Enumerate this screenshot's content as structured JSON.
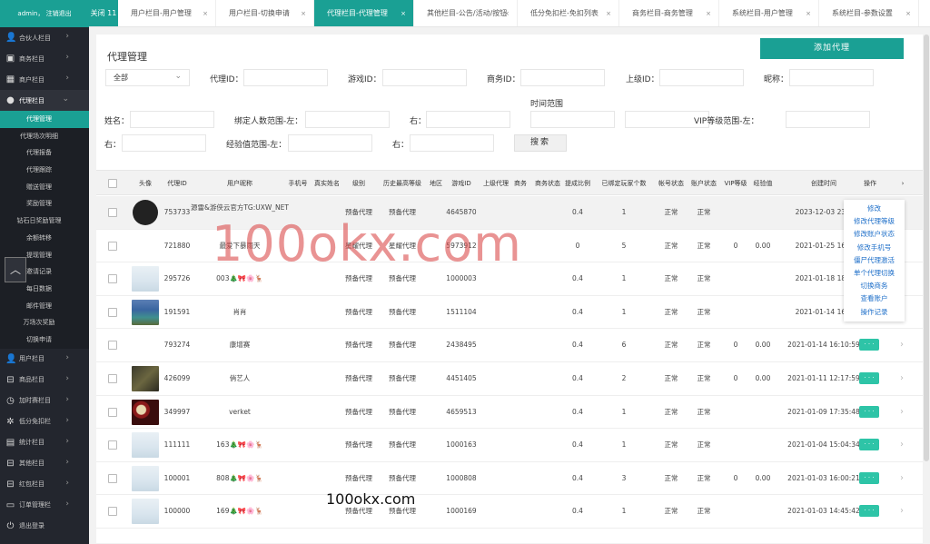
{
  "user_bar": "admin， 注销退出",
  "sidebar": {
    "items_top": [
      {
        "label": "合伙人栏目",
        "icon": "user-icon"
      },
      {
        "label": "商务栏目",
        "icon": "briefcase-icon"
      },
      {
        "label": "商户栏目",
        "icon": "shop-icon"
      },
      {
        "label": "代理栏目",
        "icon": "agent-icon"
      }
    ],
    "sub_items": [
      "代理管理",
      "代理场次明细",
      "代理报备",
      "代理跟踪",
      "赠送管理",
      "奖励管理",
      "钻石日奖励管理",
      "余额转移",
      "提现管理",
      "邀请记录",
      "每日数据",
      "邮件管理",
      "万场次奖励",
      "切换申请"
    ],
    "items_bottom": [
      {
        "label": "用户栏目",
        "icon": "user-icon"
      },
      {
        "label": "商品栏目",
        "icon": "bag-icon"
      },
      {
        "label": "加时赛栏目",
        "icon": "clock-icon"
      },
      {
        "label": "低分免扣栏",
        "icon": "gear-icon"
      },
      {
        "label": "统计栏目",
        "icon": "chart-icon"
      },
      {
        "label": "其他栏目",
        "icon": "bag-icon"
      },
      {
        "label": "红包栏目",
        "icon": "bag-icon"
      },
      {
        "label": "订单管理栏",
        "icon": "cart-icon"
      },
      {
        "label": "退出登录",
        "icon": "power-icon"
      }
    ]
  },
  "tabs": {
    "close_all": "关闭 11",
    "items": [
      {
        "label": "用户栏目-用户管理"
      },
      {
        "label": "用户栏目-切换申请"
      },
      {
        "label": "代理栏目-代理管理"
      },
      {
        "label": "其他栏目-公告/活动/按钮"
      },
      {
        "label": "低分免扣栏-免扣列表"
      },
      {
        "label": "商务栏目-商务管理"
      },
      {
        "label": "系统栏目-用户管理"
      },
      {
        "label": "系统栏目-参数设置"
      }
    ],
    "close_glyph": "×"
  },
  "page": {
    "title": "代理管理",
    "add_button": "添加代理"
  },
  "filters": {
    "select_value": "全部",
    "agent_id": "代理ID：",
    "game_id": "游戏ID：",
    "business_id": "商务ID：",
    "parent_id": "上级ID：",
    "nickname": "昵称：",
    "name": "姓名：",
    "bind_range_left": "绑定人数范围-左：",
    "right1": "右：",
    "time_range": "时间范围",
    "vip_range_left": "VIP等级范围-左：",
    "right2": "右：",
    "exp_range_left": "经验值范围-左：",
    "right3": "右：",
    "search": "搜索"
  },
  "table": {
    "headers": [
      "头像",
      "代理ID",
      "用户昵称",
      "手机号",
      "真实姓名",
      "级别",
      "历史最高等级",
      "地区",
      "游戏ID",
      "上级代理",
      "商务",
      "商务状态",
      "提成比例",
      "已绑定玩家个数",
      "帐号状态",
      "账户状态",
      "VIP等级",
      "经验值",
      "创建时间",
      "操作"
    ],
    "rows": [
      {
        "id": "753733",
        "nick": "源雷&游侠云官方TG:UXW_NET",
        "level": "预备代理",
        "hist": "预备代理",
        "game": "4645870",
        "rate": "0.4",
        "bound": "1",
        "acc": "正常",
        "bal": "正常",
        "vip": "",
        "exp": "",
        "time": "2023-12-03 23:3"
      },
      {
        "id": "721880",
        "nick": "最爱下暴雨天",
        "level": "星耀代理",
        "hist": "星耀代理",
        "game": "5973912",
        "rate": "0",
        "bound": "5",
        "acc": "正常",
        "bal": "正常",
        "vip": "0",
        "exp": "0.00",
        "time": "2021-01-25 16:4"
      },
      {
        "id": "295726",
        "nick": "003🎄🎀🌸🦌",
        "level": "预备代理",
        "hist": "预备代理",
        "game": "1000003",
        "rate": "0.4",
        "bound": "1",
        "acc": "正常",
        "bal": "正常",
        "vip": "",
        "exp": "",
        "time": "2021-01-18 18:1"
      },
      {
        "id": "191591",
        "nick": "肖肖",
        "level": "预备代理",
        "hist": "预备代理",
        "game": "1511104",
        "rate": "0.4",
        "bound": "1",
        "acc": "正常",
        "bal": "正常",
        "vip": "",
        "exp": "",
        "time": "2021-01-14 16:1"
      },
      {
        "id": "793274",
        "nick": "康增赛",
        "level": "预备代理",
        "hist": "预备代理",
        "game": "2438495",
        "rate": "0.4",
        "bound": "6",
        "acc": "正常",
        "bal": "正常",
        "vip": "0",
        "exp": "0.00",
        "time": "2021-01-14 16:10:59"
      },
      {
        "id": "426099",
        "nick": "俏艺人",
        "level": "预备代理",
        "hist": "预备代理",
        "game": "4451405",
        "rate": "0.4",
        "bound": "2",
        "acc": "正常",
        "bal": "正常",
        "vip": "0",
        "exp": "0.00",
        "time": "2021-01-11 12:17:59"
      },
      {
        "id": "349997",
        "nick": "verket",
        "level": "预备代理",
        "hist": "预备代理",
        "game": "4659513",
        "rate": "0.4",
        "bound": "1",
        "acc": "正常",
        "bal": "正常",
        "vip": "",
        "exp": "",
        "time": "2021-01-09 17:35:48"
      },
      {
        "id": "111111",
        "nick": "163🎄🎀🌸🦌",
        "level": "预备代理",
        "hist": "预备代理",
        "game": "1000163",
        "rate": "0.4",
        "bound": "1",
        "acc": "正常",
        "bal": "正常",
        "vip": "",
        "exp": "",
        "time": "2021-01-04 15:04:34"
      },
      {
        "id": "100001",
        "nick": "808🎄🎀🌸🦌",
        "level": "预备代理",
        "hist": "预备代理",
        "game": "1000808",
        "rate": "0.4",
        "bound": "3",
        "acc": "正常",
        "bal": "正常",
        "vip": "0",
        "exp": "0.00",
        "time": "2021-01-03 16:00:21"
      },
      {
        "id": "100000",
        "nick": "169🎄🎀🌸🦌",
        "level": "预备代理",
        "hist": "预备代理",
        "game": "1000169",
        "rate": "0.4",
        "bound": "1",
        "acc": "正常",
        "bal": "正常",
        "vip": "",
        "exp": "",
        "time": "2021-01-03 14:45:42"
      }
    ],
    "avatars": [
      "av-dark",
      "none",
      "av-cloud",
      "av-lake",
      "none",
      "av-game",
      "av-chips",
      "av-cloud",
      "av-cloud",
      "av-cloud"
    ],
    "op_button": "· · ·",
    "row_arrow": "›"
  },
  "op_menu": [
    "修改",
    "修改代理等级",
    "修改账户状态",
    "修改手机号",
    "僵尸代理激活",
    "单个代理切换",
    "切换商务",
    "查看账户",
    "操作记录"
  ],
  "watermarks": {
    "center": "100okx.com",
    "bottom": "100okx.com"
  }
}
